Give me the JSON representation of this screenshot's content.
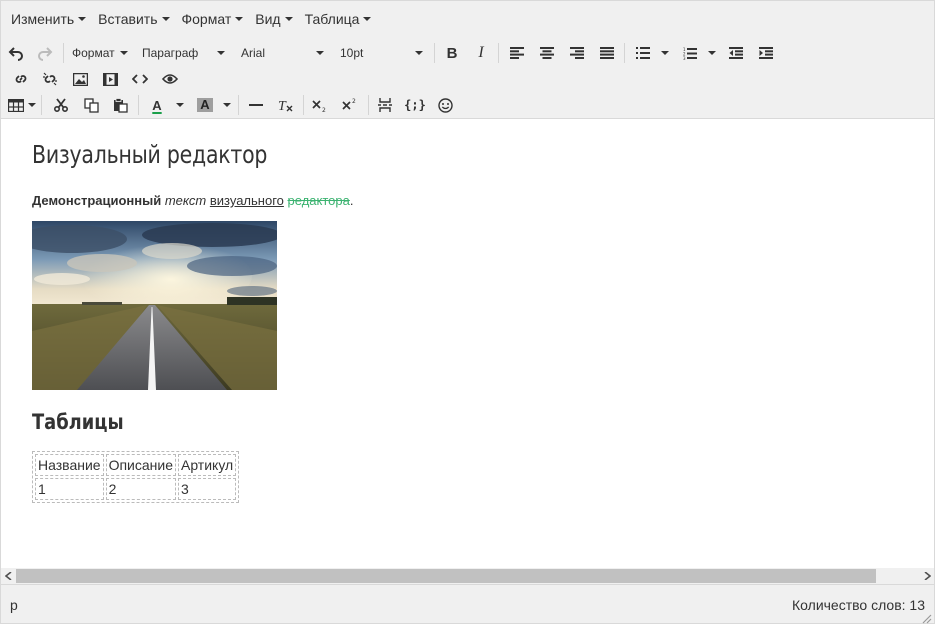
{
  "menubar": {
    "items": [
      {
        "label": "Изменить"
      },
      {
        "label": "Вставить"
      },
      {
        "label": "Формат"
      },
      {
        "label": "Вид"
      },
      {
        "label": "Таблица"
      }
    ]
  },
  "toolbar": {
    "format_label": "Формат",
    "block_label": "Параграф",
    "font_label": "Arial",
    "size_label": "10pt",
    "bold_label": "B",
    "italic_label": "I",
    "forecolor_label": "A",
    "backcolor_label": "A",
    "forecolor_color": "#1a9f4a",
    "backcolor_color": "#9e9e9e",
    "code_label": "{;}"
  },
  "document": {
    "title": "Визуальный редактор",
    "para_bold": "Демонстрационный",
    "para_italic": "текст",
    "para_underline": "визуального",
    "para_strike": "редактора",
    "para_end": ".",
    "heading2": "Таблицы",
    "table": {
      "headers": [
        "Название",
        "Описание",
        "Артикул"
      ],
      "rows": [
        [
          "1",
          "2",
          "3"
        ]
      ]
    }
  },
  "statusbar": {
    "path": "p",
    "word_count": "Количество слов: 13"
  }
}
